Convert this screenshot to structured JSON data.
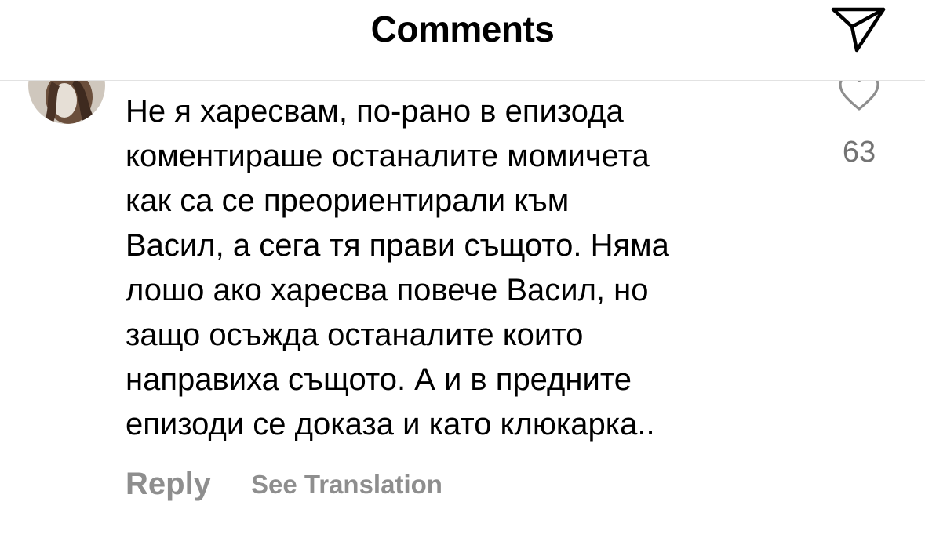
{
  "header": {
    "title": "Comments",
    "share_icon": "paper-plane-icon"
  },
  "comment": {
    "avatar_icon": "user-avatar",
    "text": "Не я харесвам, по-рано в епизода\nкоментираше останалите момичета\nкак са се преориентирали към\nВасил, а сега тя прави същото. Няма\nлошо ако харесва повече Васил, но\nзащо осъжда останалите които\nнаправиха същото. А и в предните\nепизоди се доказа и като клюкарка..",
    "like_icon": "heart-outline-icon",
    "like_count": "63",
    "reply_label": "Reply",
    "translate_label": "See Translation"
  },
  "colors": {
    "background": "#ffffff",
    "text": "#000000",
    "secondary_text": "#8e8e8e",
    "like_count": "#737373",
    "divider": "#e2e2e2"
  }
}
